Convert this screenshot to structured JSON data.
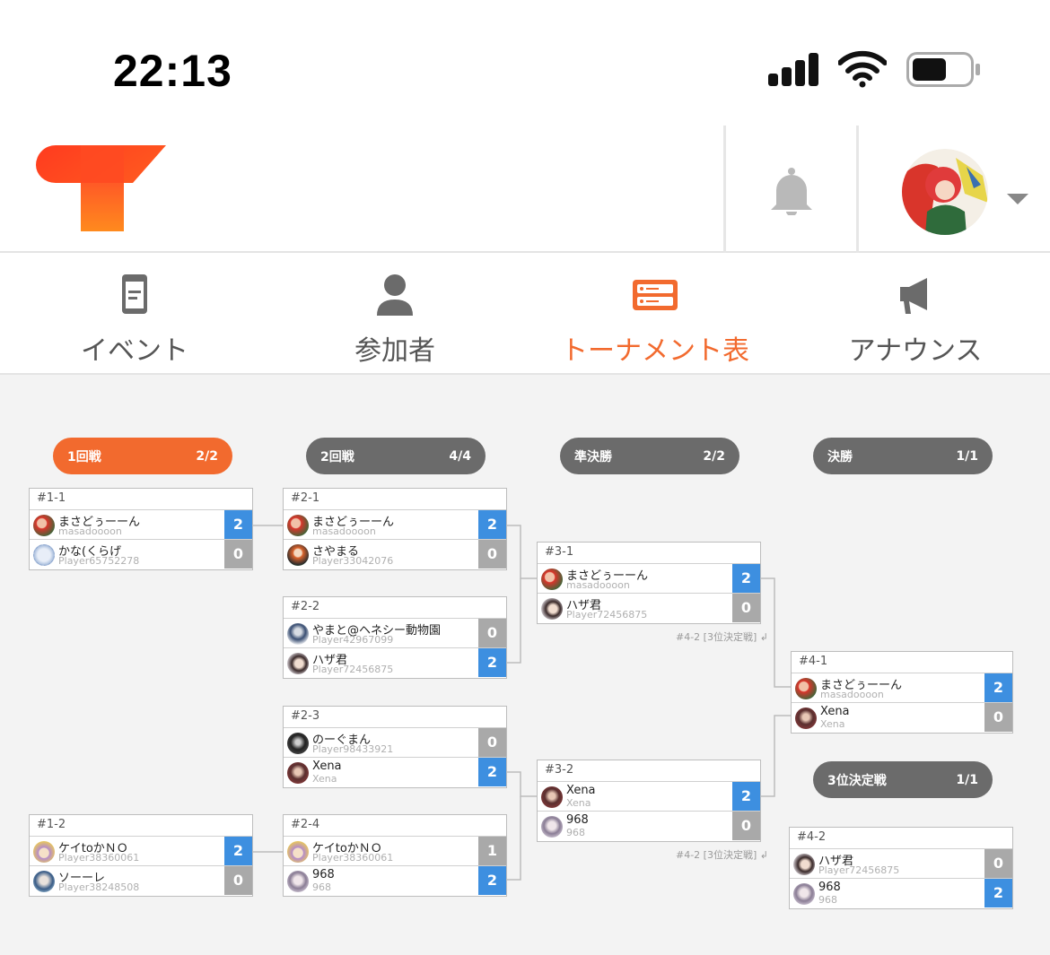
{
  "status": {
    "time": "22:13"
  },
  "tabs": [
    {
      "label": "イベント",
      "icon": "document-icon"
    },
    {
      "label": "参加者",
      "icon": "person-icon"
    },
    {
      "label": "トーナメント表",
      "icon": "bracket-icon",
      "active": true
    },
    {
      "label": "アナウンス",
      "icon": "megaphone-icon"
    }
  ],
  "colors": {
    "accent": "#f26a2e",
    "win": "#3d8fe0",
    "lose": "#a9a9a9",
    "pill_gray": "#6b6b6b"
  },
  "rounds": [
    {
      "name": "1回戦",
      "count": "2/2"
    },
    {
      "name": "2回戦",
      "count": "4/4"
    },
    {
      "name": "準決勝",
      "count": "2/2"
    },
    {
      "name": "決勝",
      "count": "1/1"
    },
    {
      "name": "3位決定戦",
      "count": "1/1"
    }
  ],
  "matches": {
    "m1_1": {
      "id": "#1-1",
      "p": [
        {
          "name": "まさどぅーーん",
          "handle": "masadoooon",
          "score": "2"
        },
        {
          "name": "かな(くらげ",
          "handle": "Player65752278",
          "score": "0"
        }
      ]
    },
    "m1_2": {
      "id": "#1-2",
      "p": [
        {
          "name": "ケイtoかＮＯ",
          "handle": "Player38360061",
          "score": "2"
        },
        {
          "name": "ソーーレ",
          "handle": "Player38248508",
          "score": "0"
        }
      ]
    },
    "m2_1": {
      "id": "#2-1",
      "p": [
        {
          "name": "まさどぅーーん",
          "handle": "masadoooon",
          "score": "2"
        },
        {
          "name": "さやまる",
          "handle": "Player33042076",
          "score": "0"
        }
      ]
    },
    "m2_2": {
      "id": "#2-2",
      "p": [
        {
          "name": "やまと@ヘネシー動物園",
          "handle": "Player42967099",
          "score": "0"
        },
        {
          "name": "ハザ君",
          "handle": "Player72456875",
          "score": "2"
        }
      ]
    },
    "m2_3": {
      "id": "#2-3",
      "p": [
        {
          "name": "のーぐまん",
          "handle": "Player98433921",
          "score": "0"
        },
        {
          "name": "Xena",
          "handle": "Xena",
          "score": "2"
        }
      ]
    },
    "m2_4": {
      "id": "#2-4",
      "p": [
        {
          "name": "ケイtoかＮＯ",
          "handle": "Player38360061",
          "score": "1"
        },
        {
          "name": "968",
          "handle": "968",
          "score": "2"
        }
      ]
    },
    "m3_1": {
      "id": "#3-1",
      "p": [
        {
          "name": "まさどぅーーん",
          "handle": "masadoooon",
          "score": "2"
        },
        {
          "name": "ハザ君",
          "handle": "Player72456875",
          "score": "0"
        }
      ]
    },
    "m3_2": {
      "id": "#3-2",
      "p": [
        {
          "name": "Xena",
          "handle": "Xena",
          "score": "2"
        },
        {
          "name": "968",
          "handle": "968",
          "score": "0"
        }
      ]
    },
    "m4_1": {
      "id": "#4-1",
      "p": [
        {
          "name": "まさどぅーーん",
          "handle": "masadoooon",
          "score": "2"
        },
        {
          "name": "Xena",
          "handle": "Xena",
          "score": "0"
        }
      ]
    },
    "m4_2": {
      "id": "#4-2",
      "p": [
        {
          "name": "ハザ君",
          "handle": "Player72456875",
          "score": "0"
        },
        {
          "name": "968",
          "handle": "968",
          "score": "2"
        }
      ]
    }
  },
  "notes": {
    "third_place": "#4-2 [3位決定戦] ↲"
  }
}
